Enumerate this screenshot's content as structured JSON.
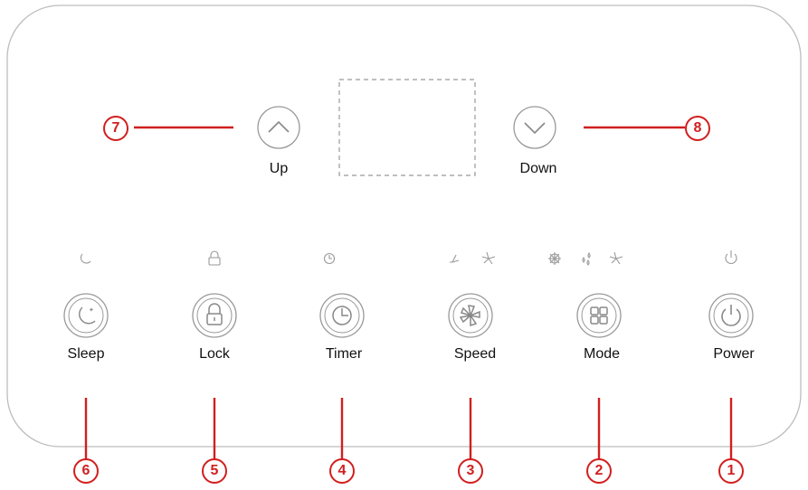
{
  "panel": {
    "arrows": {
      "up_label": "Up",
      "down_label": "Down"
    },
    "buttons": [
      {
        "label": "Sleep",
        "icon": "moon-stars-icon",
        "callout": "6",
        "indicators": [
          "moon-indicator-icon"
        ]
      },
      {
        "label": "Lock",
        "icon": "padlock-icon",
        "callout": "5",
        "indicators": [
          "lock-indicator-icon"
        ]
      },
      {
        "label": "Timer",
        "icon": "clock-icon",
        "callout": "4",
        "indicators": [
          "clock-indicator-icon"
        ]
      },
      {
        "label": "Speed",
        "icon": "fan-icon",
        "callout": "3",
        "indicators": [
          "fan-low-indicator-icon",
          "fan-high-indicator-icon"
        ]
      },
      {
        "label": "Mode",
        "icon": "grid-icon",
        "callout": "2",
        "indicators": [
          "snowflake-indicator-icon",
          "droplets-indicator-icon",
          "fan-indicator-icon"
        ]
      },
      {
        "label": "Power",
        "icon": "power-icon",
        "callout": "1",
        "indicators": [
          "power-indicator-icon"
        ]
      }
    ],
    "callouts": {
      "up": "7",
      "down": "8"
    }
  },
  "colors": {
    "callout_red": "#d11f1f",
    "outline_gray": "#9a9a9a",
    "icon_gray": "#888888"
  }
}
